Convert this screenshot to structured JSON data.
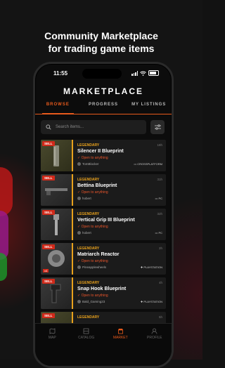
{
  "headline": {
    "line1": "Community Marketplace",
    "line2": "for trading game items"
  },
  "status_bar": {
    "time": "11:55"
  },
  "app": {
    "title": "MARKETPLACE",
    "tabs": [
      {
        "label": "BROWSE",
        "active": true
      },
      {
        "label": "PROGRESS",
        "active": false
      },
      {
        "label": "MY LISTINGS",
        "active": false
      }
    ],
    "search": {
      "placeholder": "Search items..."
    },
    "listings": [
      {
        "badge": "SELL",
        "rarity": "LEGENDARY",
        "name": "Silencer II Blueprint",
        "price": "18h",
        "trade": "Open to anything",
        "user": "TomBlocker",
        "platform": "CROSSPLATFORM"
      },
      {
        "badge": "SELL",
        "rarity": "LEGENDARY",
        "name": "Bettina Blueprint",
        "price": "31h",
        "trade": "Open to anything",
        "user": "hobert",
        "platform": "PC"
      },
      {
        "badge": "SELL",
        "rarity": "LEGENDARY",
        "name": "Vertical Grip III Blueprint",
        "price": "32h",
        "trade": "Open to anything",
        "user": "hobert",
        "platform": "PC"
      },
      {
        "badge": "SELL",
        "rarity": "LEGENDARY",
        "name": "Matriarch Reactor",
        "price": "2h",
        "trade": "Open to anything",
        "user": "Pineapplewheels",
        "platform": "PLAYSTATION",
        "count": "x4"
      },
      {
        "badge": "SELL",
        "rarity": "LEGENDARY",
        "name": "Snap Hook Blueprint",
        "price": "4h",
        "trade": "Open to anything",
        "user": "Bald_Gaming23",
        "platform": "PLAYSTATION"
      },
      {
        "badge": "SELL",
        "rarity": "LEGENDARY",
        "name": "",
        "price": "5h",
        "trade": "",
        "user": "",
        "platform": ""
      }
    ],
    "nav": [
      {
        "label": "MAP",
        "icon": "map-icon",
        "active": false
      },
      {
        "label": "CATALOG",
        "icon": "catalog-icon",
        "active": false
      },
      {
        "label": "MARKET",
        "icon": "market-icon",
        "active": true
      },
      {
        "label": "PROFILE",
        "icon": "profile-icon",
        "active": false
      }
    ]
  },
  "colors": {
    "accent": "#e85a1c",
    "rarity": "#e8a11c",
    "sell": "#d12a1a",
    "background": "#0c0c0c"
  }
}
